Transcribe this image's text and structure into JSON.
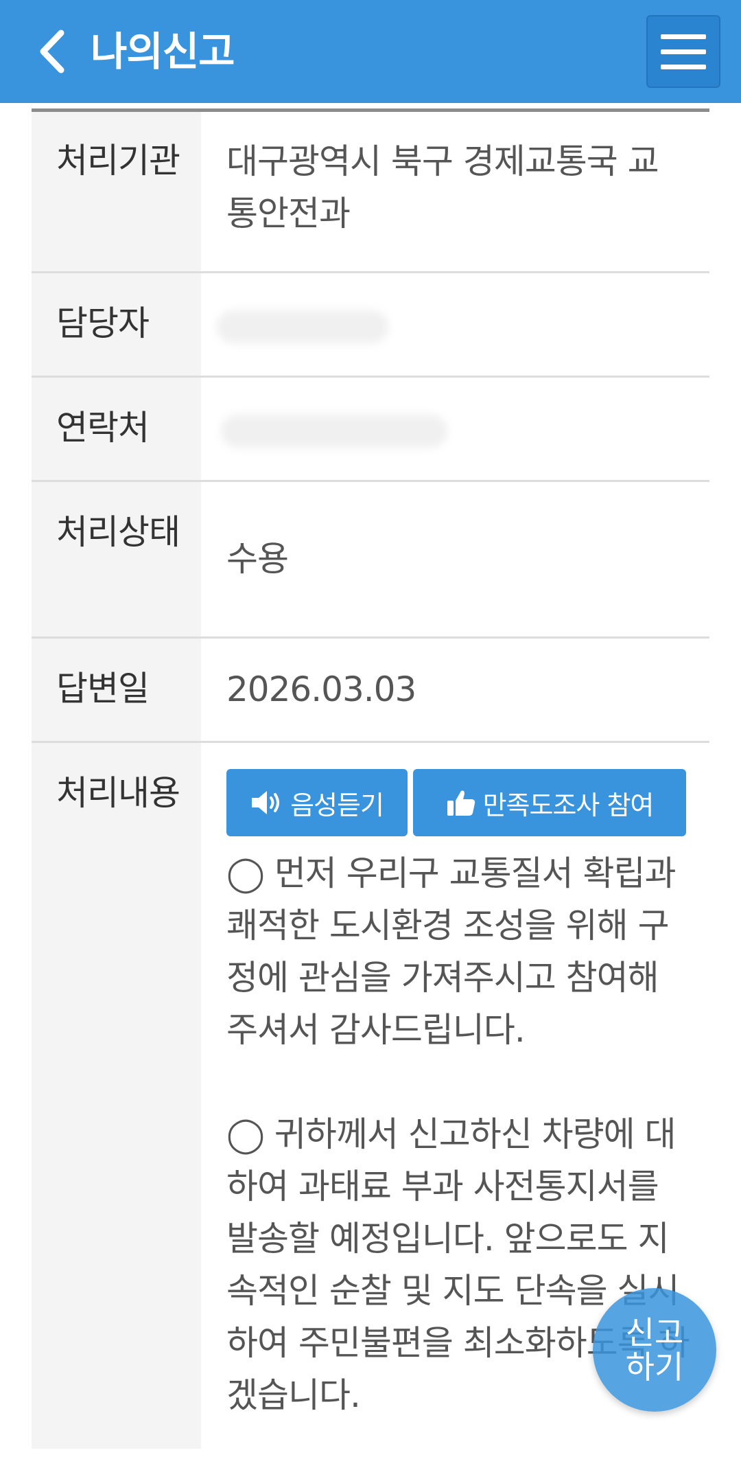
{
  "header": {
    "title": "나의신고",
    "back_icon": "chevron-left-icon",
    "menu_icon": "hamburger-menu-icon",
    "background": "#3a94dd"
  },
  "rows": {
    "agency": {
      "label": "처리기관",
      "value": "대구광역시 북구 경제교통국 교통안전과"
    },
    "manager": {
      "label": "담당자",
      "value": ""
    },
    "contact": {
      "label": "연락처",
      "value": ""
    },
    "status": {
      "label": "처리상태",
      "value": "수용",
      "color": "#3a94dd"
    },
    "answer_date": {
      "label": "답변일",
      "value": "2026.03.03"
    },
    "content": {
      "label": "처리내용",
      "buttons": [
        {
          "label": "음성듣기",
          "icon": "speaker-icon"
        },
        {
          "label": "만족도조사 참여",
          "icon": "thumbs-up-icon"
        }
      ],
      "paragraph1": "◯ 먼저 우리구 교통질서 확립과 쾌적한 도시환경 조성을 위해 구정에 관심을 가져주시고 참여해 주셔서 감사드립니다.",
      "paragraph2": "◯ 귀하께서 신고하신 차량에 대하여 과태료 부과 사전통지서를 발송할 예정입니다. 앞으로도 지속적인 순찰 및 지도 단속을 실시하여 주민불편을 최소화하도록 하겠습니다."
    }
  },
  "fab": {
    "line1": "신고",
    "line2": "하기"
  }
}
